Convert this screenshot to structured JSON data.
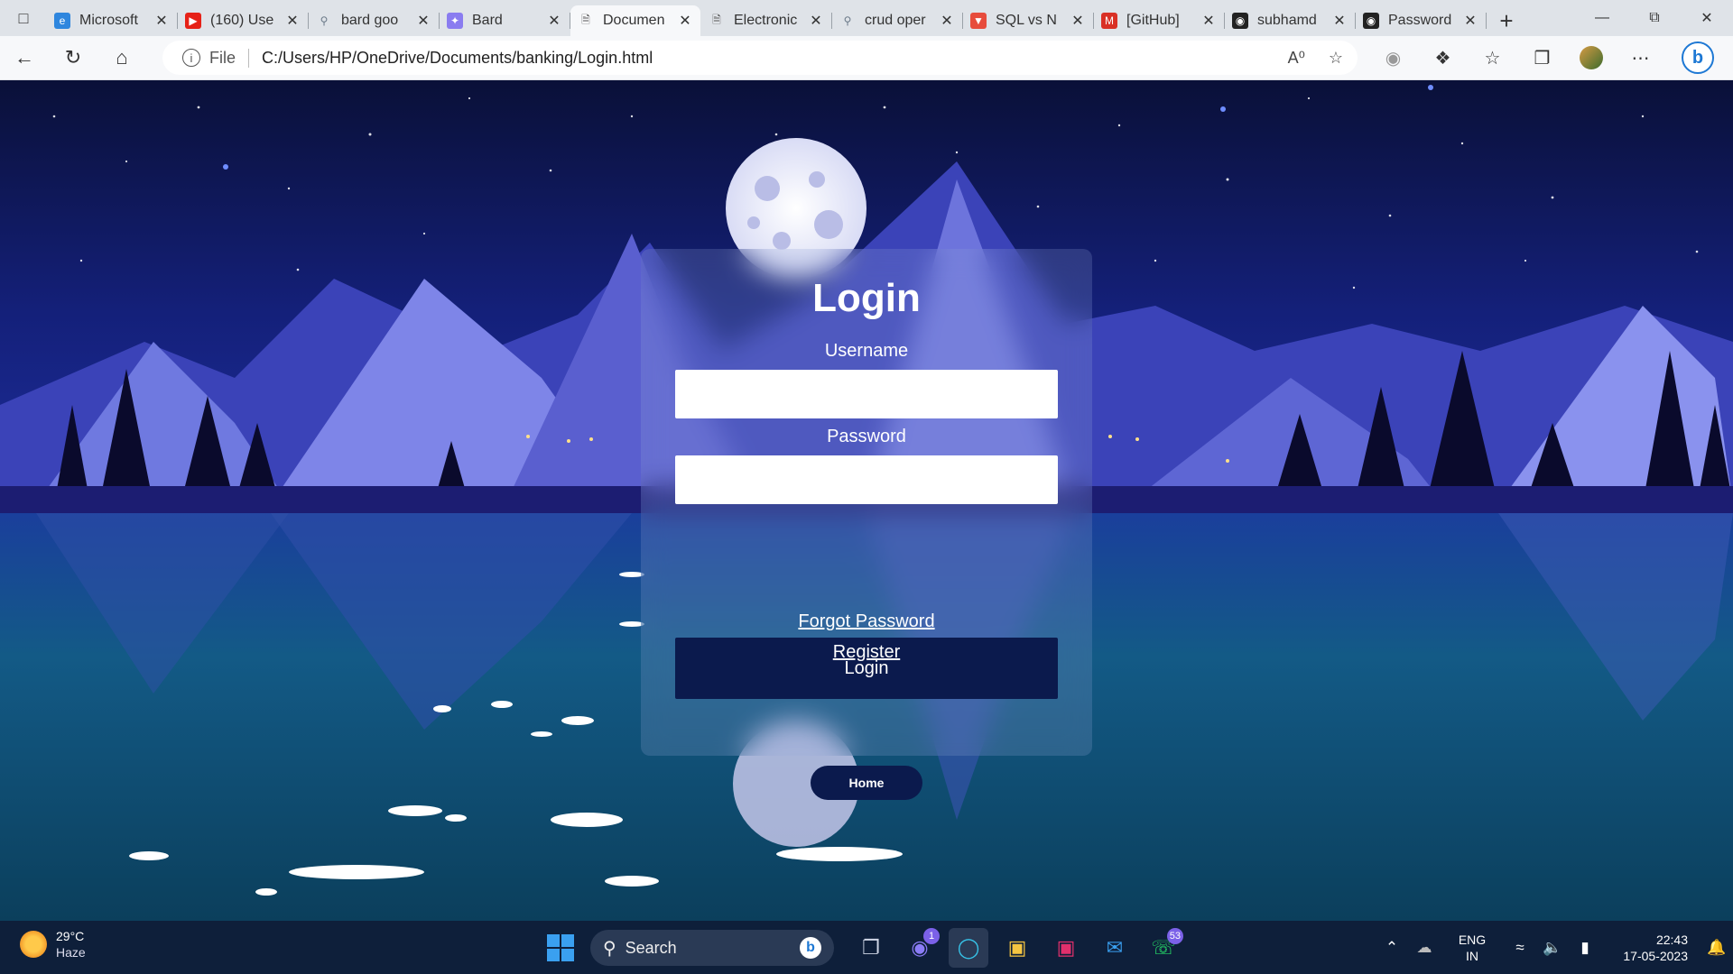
{
  "browser": {
    "tabs": [
      {
        "title": "Microsoft",
        "icon": "edge-icon",
        "color": "#2e86de"
      },
      {
        "title": "(160) Use",
        "icon": "youtube-icon",
        "color": "#e62117"
      },
      {
        "title": "bard goo",
        "icon": "search-icon",
        "color": "#6c7a89"
      },
      {
        "title": "Bard",
        "icon": "bard-icon",
        "color": "#8a7cf0"
      },
      {
        "title": "Documen",
        "icon": "document-icon",
        "color": "#555555",
        "active": true
      },
      {
        "title": "Electronic",
        "icon": "document-icon",
        "color": "#555555"
      },
      {
        "title": "crud oper",
        "icon": "search-icon",
        "color": "#6c7a89"
      },
      {
        "title": "SQL vs N",
        "icon": "vercel-icon",
        "color": "#e74c3c"
      },
      {
        "title": "[GitHub]",
        "icon": "gmail-icon",
        "color": "#d93025"
      },
      {
        "title": "subhamd",
        "icon": "github-icon",
        "color": "#222222"
      },
      {
        "title": "Password",
        "icon": "github-icon",
        "color": "#222222"
      }
    ],
    "address": {
      "scheme": "File",
      "url": "C:/Users/HP/OneDrive/Documents/banking/Login.html"
    }
  },
  "login": {
    "title": "Login",
    "username_label": "Username",
    "password_label": "Password",
    "username_value": "",
    "password_value": "",
    "submit_label": "Login",
    "forgot_link": "Forgot Password",
    "register_link": "Register",
    "home_label": "Home"
  },
  "taskbar": {
    "weather_temp": "29°C",
    "weather_condition": "Haze",
    "search_placeholder": "Search",
    "teams_badge": "1",
    "whatsapp_badge": "53",
    "lang_primary": "ENG",
    "lang_secondary": "IN",
    "time": "22:43",
    "date": "17-05-2023"
  },
  "colors": {
    "button_navy": "#0b1a4d",
    "sky_top": "#0b1340",
    "lake": "#0e5a74"
  }
}
